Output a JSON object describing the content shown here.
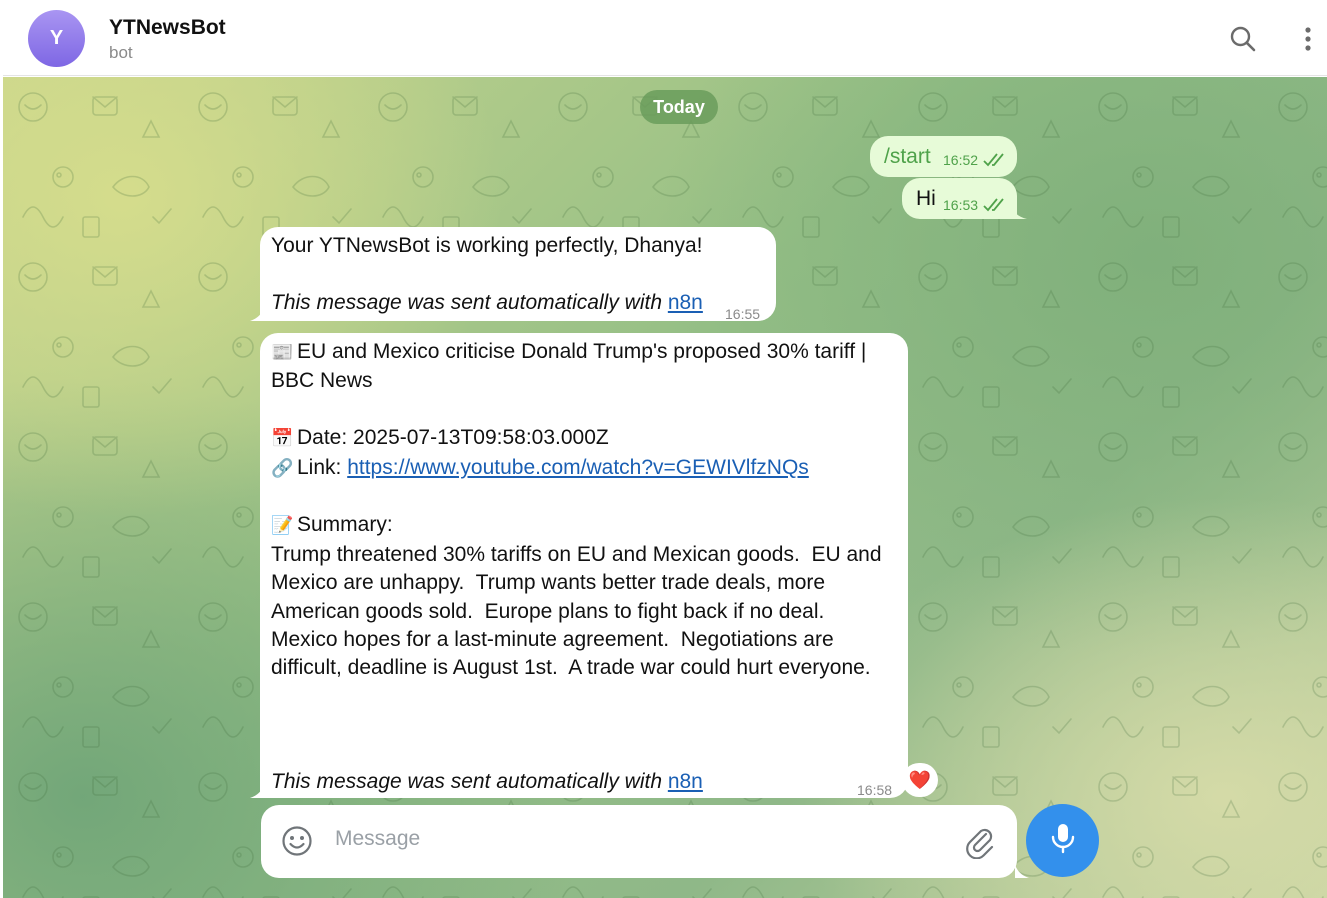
{
  "header": {
    "avatar_letter": "Y",
    "title": "YTNewsBot",
    "subtitle": "bot"
  },
  "chat": {
    "date_label": "Today",
    "outgoing": [
      {
        "text": "/start",
        "time": "16:52"
      },
      {
        "text": "Hi",
        "time": "16:53"
      }
    ],
    "msg1": {
      "line1": "Your YTNewsBot is working perfectly, Dhanya!",
      "footer": "This message was sent automatically with ",
      "footer_link": "n8n",
      "time": "16:55"
    },
    "msg2": {
      "title_line1": "EU and Mexico criticise Donald Trump's proposed 30% tariff |",
      "title_line2": "BBC News",
      "date_label": "Date: ",
      "date_value": "2025-07-13T09:58:03.000Z",
      "link_label": "Link: ",
      "link_url": "https://www.youtube.com/watch?v=GEWIVlfzNQs",
      "summary_label": "Summary:",
      "summary_lines": [
        "Trump threatened 30% tariffs on EU and Mexican goods.  EU and",
        "Mexico are unhappy.  Trump wants better trade deals, more",
        "American goods sold.  Europe plans to fight back if no deal.",
        "Mexico hopes for a last-minute agreement.  Negotiations are",
        "difficult, deadline is August 1st.  A trade war could hurt everyone."
      ],
      "footer": "This message was sent automatically with ",
      "footer_link": "n8n",
      "time": "16:58",
      "reaction": "❤️"
    }
  },
  "composer": {
    "placeholder": "Message"
  },
  "icons": {
    "search": "search-icon",
    "more": "more-vertical-icon",
    "emoji": "emoji-icon",
    "attach": "paperclip-icon",
    "mic": "microphone-icon"
  },
  "colors": {
    "accent": "#3390ec",
    "outgoing_bubble": "#e7fbd8",
    "outgoing_time": "#4fa24a",
    "avatar": "#8f7ae8",
    "link": "#1a5fb4"
  }
}
